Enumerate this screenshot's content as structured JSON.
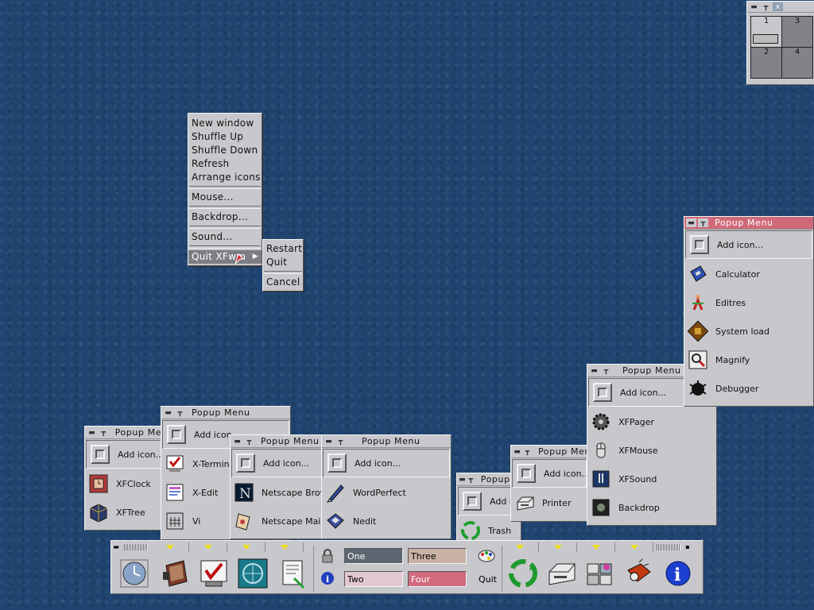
{
  "pager": {
    "title_btn": "x",
    "desks": [
      "1",
      "2",
      "3",
      "4"
    ]
  },
  "root_menu": {
    "items": [
      {
        "label": "New window"
      },
      {
        "label": "Shuffle Up"
      },
      {
        "label": "Shuffle Down"
      },
      {
        "label": "Refresh"
      },
      {
        "label": "Arrange icons"
      },
      {
        "label": "Mouse..."
      },
      {
        "label": "Backdrop..."
      },
      {
        "label": "Sound..."
      },
      {
        "label": "Quit XFwm"
      }
    ],
    "submenu": [
      {
        "label": "Restart"
      },
      {
        "label": "Quit"
      },
      {
        "label": "Cancel"
      }
    ]
  },
  "popups": {
    "p1": {
      "title": "Popup Menu",
      "items": [
        "Add icon...",
        "XFClock",
        "XFTree"
      ]
    },
    "p2": {
      "title": "Popup Menu",
      "items": [
        "Add icon...",
        "X-Terminal",
        "X-Edit",
        "Vi"
      ]
    },
    "p3": {
      "title": "Popup Menu",
      "items": [
        "Add icon...",
        "Netscape Browser",
        "Netscape Mail"
      ]
    },
    "p4": {
      "title": "Popup Menu",
      "items": [
        "Add icon...",
        "WordPerfect",
        "Nedit"
      ]
    },
    "p5": {
      "title": "Popup Menu",
      "items": [
        "Add icon...",
        "Trash"
      ]
    },
    "p6": {
      "title": "Popup Menu",
      "items": [
        "Add icon...",
        "Printer"
      ]
    },
    "p7": {
      "title": "Popup Menu",
      "items": [
        "Add icon...",
        "XFPager",
        "XFMouse",
        "XFSound",
        "Backdrop"
      ]
    },
    "p8": {
      "title": "Popup Menu",
      "items": [
        "Add icon...",
        "Calculator",
        "Editres",
        "System load",
        "Magnify",
        "Debugger"
      ]
    }
  },
  "panel": {
    "workspaces": [
      "One",
      "Two",
      "Three",
      "Four"
    ],
    "ws_colors": {
      "one": "#5d6670",
      "two": "#e3c8cf",
      "three": "#c9b2a4",
      "four": "#cf6b7d"
    },
    "quit_label": "Quit",
    "icons_left": [
      "clock-icon",
      "file-manager-icon",
      "terminal-icon",
      "netscape-icon",
      "editor-icon"
    ],
    "icons_right": [
      "trash-icon",
      "printer-icon",
      "pager-icon",
      "mouse-config-icon",
      "info-icon"
    ]
  },
  "colors": {
    "desktop": "#1f4470",
    "panel_grey": "#c8c8cc",
    "active_title": "#d06a7a",
    "arrow_yellow": "#f0e020"
  }
}
